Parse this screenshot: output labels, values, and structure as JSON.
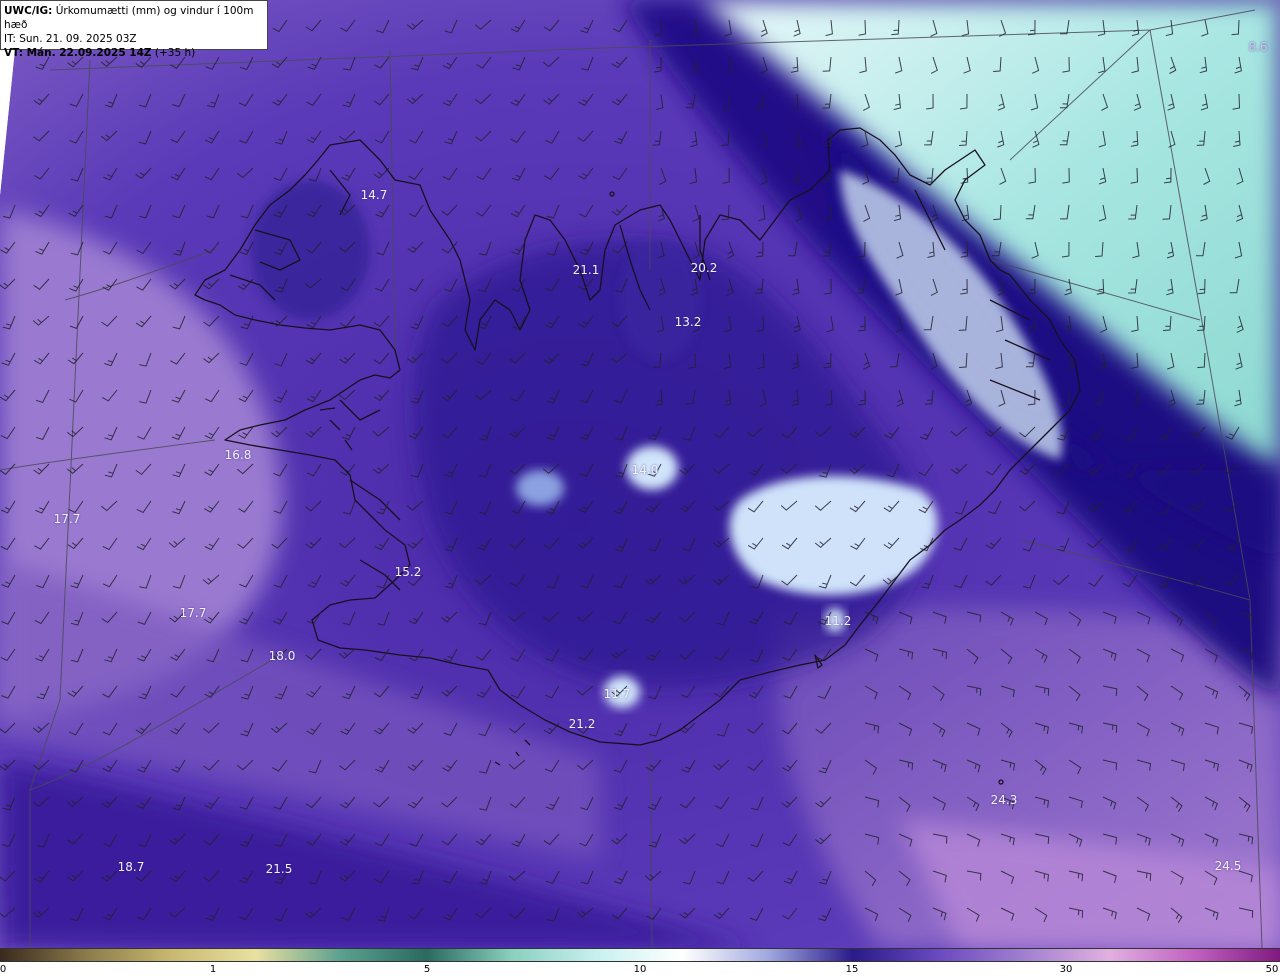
{
  "header": {
    "product": "UWC/IG:",
    "description": "Úrkomumætti (mm) og vindur í 100m hæð",
    "issue_time": "IT: Sun. 21. 09. 2025 03Z",
    "valid_label": "VT: Mán. 22.09.2025 14Z",
    "lead_time": "(+35 h)"
  },
  "labels": [
    {
      "id": "lbl-1",
      "text": "14.7",
      "pos": [
        374,
        195
      ]
    },
    {
      "id": "lbl-2",
      "text": "21.1",
      "pos": [
        586,
        270
      ]
    },
    {
      "id": "lbl-3",
      "text": "20.2",
      "pos": [
        704,
        268
      ]
    },
    {
      "id": "lbl-4",
      "text": "13.2",
      "pos": [
        688,
        322
      ]
    },
    {
      "id": "lbl-5",
      "text": "16.8",
      "pos": [
        238,
        455
      ]
    },
    {
      "id": "lbl-6",
      "text": "14.0",
      "pos": [
        645,
        470
      ]
    },
    {
      "id": "lbl-7",
      "text": "17.7",
      "pos": [
        67,
        519
      ]
    },
    {
      "id": "lbl-8",
      "text": "15.2",
      "pos": [
        408,
        572
      ]
    },
    {
      "id": "lbl-9",
      "text": "17.7",
      "pos": [
        193,
        613
      ]
    },
    {
      "id": "lbl-10",
      "text": "11.2",
      "pos": [
        838,
        621
      ]
    },
    {
      "id": "lbl-11",
      "text": "18.0",
      "pos": [
        282,
        656
      ]
    },
    {
      "id": "lbl-12",
      "text": "11.7",
      "pos": [
        617,
        694
      ]
    },
    {
      "id": "lbl-13",
      "text": "21.2",
      "pos": [
        582,
        724
      ]
    },
    {
      "id": "lbl-14",
      "text": "24.3",
      "pos": [
        1004,
        800
      ]
    },
    {
      "id": "lbl-15",
      "text": "18.7",
      "pos": [
        131,
        867
      ]
    },
    {
      "id": "lbl-16",
      "text": "21.5",
      "pos": [
        279,
        869
      ]
    },
    {
      "id": "lbl-17",
      "text": "24.5",
      "pos": [
        1228,
        866
      ]
    },
    {
      "id": "lbl-18",
      "text": "8.6",
      "pos": [
        1258,
        47
      ]
    }
  ],
  "colorbar": {
    "ticks": [
      "0",
      "1",
      "5",
      "10",
      "15",
      "30",
      "50"
    ],
    "colors": [
      "#3a2a1e",
      "#8a7a4a",
      "#c8b870",
      "#e8e0a0",
      "#5aa090",
      "#2a6a60",
      "#8ad0c0",
      "#c8f0f0",
      "#ffffff",
      "#a0a8e0",
      "#2a1a8a",
      "#6a4ac0",
      "#a080d0",
      "#e0b0e0",
      "#c060c0",
      "#801a80"
    ]
  }
}
